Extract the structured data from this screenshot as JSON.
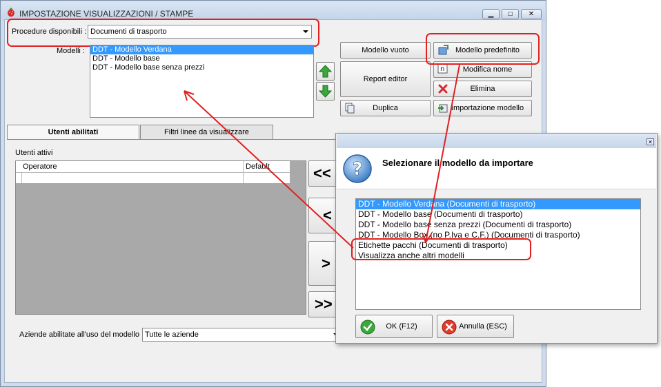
{
  "window": {
    "title": "IMPOSTAZIONE VISUALIZZAZIONI / STAMPE",
    "controls": [
      "minimize",
      "maximize",
      "close"
    ]
  },
  "procedure": {
    "label": "Procedure disponibili :",
    "value": "Documenti di trasporto"
  },
  "models": {
    "label": "Modelli :",
    "items": [
      "DDT - Modello Verdana",
      "DDT - Modello base",
      "DDT - Modello base senza prezzi"
    ],
    "selected_index": 0
  },
  "buttons": {
    "empty_model": "Modello vuoto",
    "report_editor": "Report editor",
    "duplicate": "Duplica",
    "default_model": "Modello predefinito",
    "rename": "Modifica nome",
    "delete": "Elimina",
    "import_model": "Importazione modello"
  },
  "tabs": [
    "Utenti abilitati",
    "Filtri linee da visualizzare"
  ],
  "users": {
    "label": "Utenti attivi",
    "columns": [
      "Operatore",
      "Default"
    ],
    "transfer_buttons": [
      "<<",
      "<",
      ">",
      ">>"
    ]
  },
  "companies": {
    "label": "Aziende abilitate all'uso del modello :",
    "value": "Tutte le aziende"
  },
  "dialog": {
    "header": "Selezionare il modello da importare",
    "items": [
      "DDT - Modello Verdana (Documenti di trasporto)",
      "DDT - Modello base (Documenti di trasporto)",
      "DDT - Modello base senza prezzi (Documenti di trasporto)",
      "DDT - Modello Box (no P.Iva e C.F.) (Documenti di trasporto)",
      "Etichette pacchi (Documenti di trasporto)",
      "Visualizza anche altri modelli"
    ],
    "selected_index": 0,
    "ok_label": "OK (F12)",
    "cancel_label": "Annulla (ESC)"
  },
  "colors": {
    "highlight": "#e02020",
    "selection": "#3399ff",
    "arrow_up_down": "#2e9a2e"
  }
}
